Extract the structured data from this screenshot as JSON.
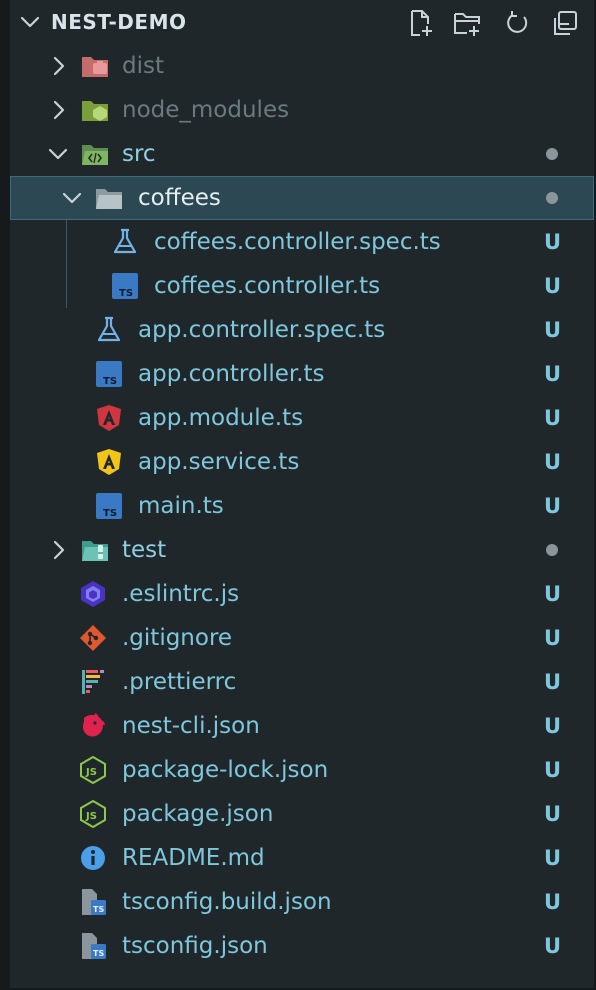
{
  "explorer": {
    "title": "NEST-DEMO",
    "actions": {
      "new_file": "new-file-icon",
      "new_folder": "new-folder-icon",
      "refresh": "refresh-icon",
      "collapse": "collapse-all-icon"
    }
  },
  "tree": [
    {
      "name": "dist",
      "type": "folder",
      "depth": 1,
      "expanded": false,
      "icon": "folder-dist-icon",
      "status": ""
    },
    {
      "name": "node_modules",
      "type": "folder",
      "depth": 1,
      "expanded": false,
      "icon": "folder-node-icon",
      "status": ""
    },
    {
      "name": "src",
      "type": "folder",
      "depth": 1,
      "expanded": true,
      "icon": "folder-src-icon",
      "status": "modified-dot"
    },
    {
      "name": "coffees",
      "type": "folder",
      "depth": 2,
      "expanded": true,
      "icon": "folder-icon",
      "status": "modified-dot",
      "selected": true
    },
    {
      "name": "coffees.controller.spec.ts",
      "type": "file",
      "depth": 3,
      "icon": "test-flask-icon",
      "status": "U"
    },
    {
      "name": "coffees.controller.ts",
      "type": "file",
      "depth": 3,
      "icon": "typescript-icon",
      "status": "U"
    },
    {
      "name": "app.controller.spec.ts",
      "type": "file",
      "depth": 2,
      "icon": "test-flask-icon",
      "status": "U"
    },
    {
      "name": "app.controller.ts",
      "type": "file",
      "depth": 2,
      "icon": "typescript-icon",
      "status": "U"
    },
    {
      "name": "app.module.ts",
      "type": "file",
      "depth": 2,
      "icon": "angular-red-icon",
      "status": "U"
    },
    {
      "name": "app.service.ts",
      "type": "file",
      "depth": 2,
      "icon": "angular-yellow-icon",
      "status": "U"
    },
    {
      "name": "main.ts",
      "type": "file",
      "depth": 2,
      "icon": "typescript-icon",
      "status": "U"
    },
    {
      "name": "test",
      "type": "folder",
      "depth": 1,
      "expanded": false,
      "icon": "folder-test-icon",
      "status": "modified-dot"
    },
    {
      "name": ".eslintrc.js",
      "type": "file",
      "depth": 1,
      "icon": "eslint-icon",
      "status": "U"
    },
    {
      "name": ".gitignore",
      "type": "file",
      "depth": 1,
      "icon": "git-icon",
      "status": "U"
    },
    {
      "name": ".prettierrc",
      "type": "file",
      "depth": 1,
      "icon": "prettier-icon",
      "status": "U"
    },
    {
      "name": "nest-cli.json",
      "type": "file",
      "depth": 1,
      "icon": "nestjs-icon",
      "status": "U"
    },
    {
      "name": "package-lock.json",
      "type": "file",
      "depth": 1,
      "icon": "nodejs-icon",
      "status": "U"
    },
    {
      "name": "package.json",
      "type": "file",
      "depth": 1,
      "icon": "nodejs-icon",
      "status": "U"
    },
    {
      "name": "README.md",
      "type": "file",
      "depth": 1,
      "icon": "info-icon",
      "status": "U"
    },
    {
      "name": "tsconfig.build.json",
      "type": "file",
      "depth": 1,
      "icon": "tsconfig-icon",
      "status": "U"
    },
    {
      "name": "tsconfig.json",
      "type": "file",
      "depth": 1,
      "icon": "tsconfig-icon",
      "status": "U"
    }
  ],
  "colors": {
    "background": "#20272b",
    "untracked": "#7ec7dc",
    "selected_row": "#2b4853",
    "ignored": "#6b7a80"
  }
}
